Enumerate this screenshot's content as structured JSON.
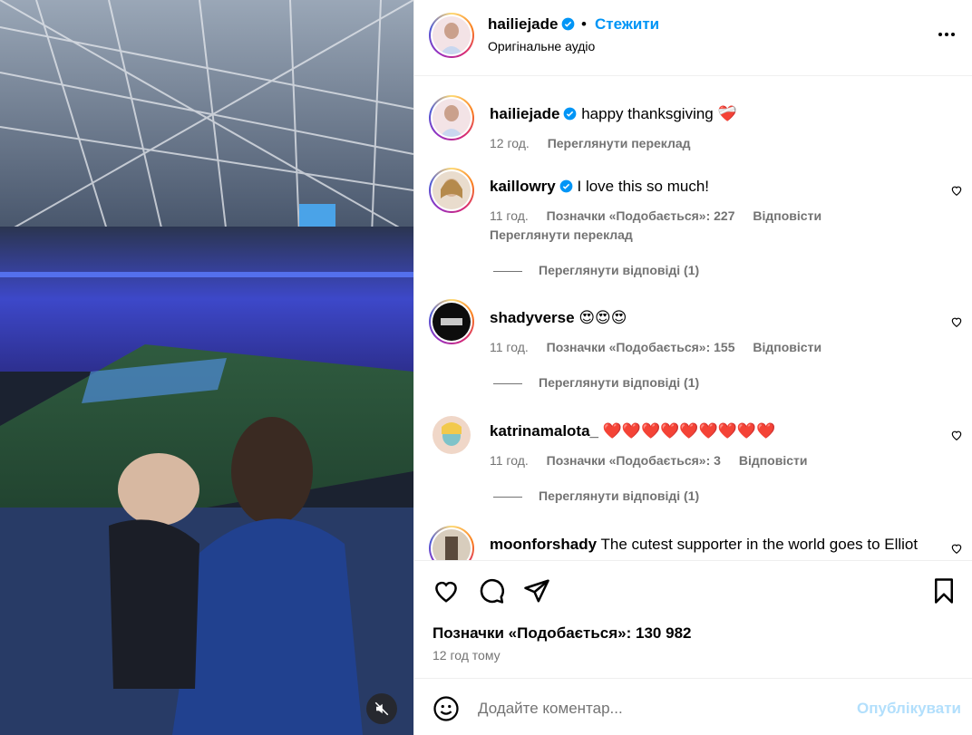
{
  "post": {
    "author": "hailiejade",
    "follow_label": "Стежити",
    "dot": "•",
    "audio": "Оригінальне аудіо"
  },
  "caption": {
    "username": "hailiejade",
    "text": "happy thanksgiving",
    "emoji": "❤️‍🩹",
    "time": "12 год.",
    "translate": "Переглянути переклад"
  },
  "comments": [
    {
      "username": "kaillowry",
      "verified": true,
      "text": "I love this so much!",
      "time": "11 год.",
      "likes": "Позначки «Подобається»: 227",
      "reply": "Відповісти",
      "translate": "Переглянути переклад",
      "view_replies": "Переглянути відповіді (1)"
    },
    {
      "username": "shadyverse",
      "verified": false,
      "text": "😍😍😍",
      "time": "11 год.",
      "likes": "Позначки «Подобається»: 155",
      "reply": "Відповісти",
      "view_replies": "Переглянути відповіді (1)"
    },
    {
      "username": "katrinamalota_",
      "verified": false,
      "text": "❤️❤️❤️❤️❤️❤️❤️❤️❤️",
      "time": "11 год.",
      "likes": "Позначки «Подобається»: 3",
      "reply": "Відповісти",
      "view_replies": "Переглянути відповіді (1)"
    },
    {
      "username": "moonforshady",
      "verified": false,
      "text": "The cutest supporter in the world goes to Elliot"
    }
  ],
  "footer": {
    "likes": "Позначки «Подобається»: 130 982",
    "time": "12 год тому"
  },
  "composer": {
    "placeholder": "Додайте коментар...",
    "post_label": "Опублікувати"
  },
  "icons": {
    "verified": "verified-badge-icon",
    "more": "more-options-icon",
    "like": "heart-icon",
    "comment": "comment-icon",
    "share": "share-icon",
    "save": "bookmark-icon",
    "emoji": "emoji-icon",
    "mute": "sound-off-icon"
  },
  "colors": {
    "accent": "#0095f6",
    "muted_text": "#737373",
    "post_disabled": "#b2dffc",
    "verified": "#0095f6"
  }
}
